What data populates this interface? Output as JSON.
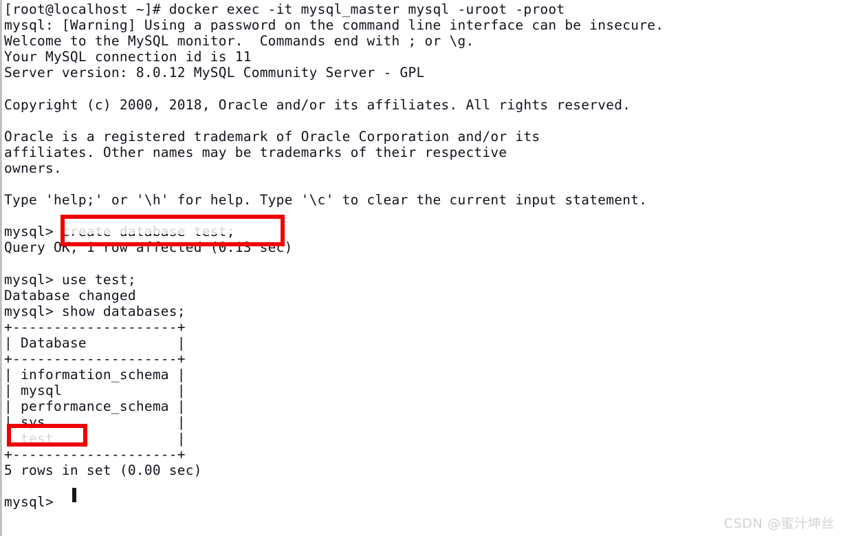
{
  "terminal": {
    "title": "MySQL monitor session in docker container",
    "background_color": "#ffffff",
    "text_color": "#13131f",
    "font_size_px": 19.5,
    "line_height_px": 23.1,
    "lines": [
      "[root@localhost ~]# docker exec -it mysql_master mysql -uroot -proot",
      "mysql: [Warning] Using a password on the command line interface can be insecure.",
      "Welcome to the MySQL monitor.  Commands end with ; or \\g.",
      "Your MySQL connection id is 11",
      "Server version: 8.0.12 MySQL Community Server - GPL",
      "",
      "Copyright (c) 2000, 2018, Oracle and/or its affiliates. All rights reserved.",
      "",
      "Oracle is a registered trademark of Oracle Corporation and/or its",
      "affiliates. Other names may be trademarks of their respective",
      "owners.",
      "",
      "Type 'help;' or '\\h' for help. Type '\\c' to clear the current input statement.",
      "",
      "mysql> create database test;",
      "Query OK, 1 row affected (0.13 sec)",
      "",
      "mysql> use test;",
      "Database changed",
      "mysql> show databases;",
      "+--------------------+",
      "| Database           |",
      "+--------------------+",
      "| information_schema |",
      "| mysql              |",
      "| performance_schema |",
      "| sys                |",
      "| test               |",
      "+--------------------+",
      "5 rows in set (0.00 sec)",
      "",
      "mysql> "
    ]
  },
  "session": {
    "shell_prompt": "[root@localhost ~]#",
    "shell_command": "docker exec -it mysql_master mysql -uroot -proot",
    "container_name": "mysql_master",
    "db_user": "root",
    "db_password": "root",
    "warning": "mysql: [Warning] Using a password on the command line interface can be insecure.",
    "welcome": "Welcome to the MySQL monitor.  Commands end with ; or \\g.",
    "connection_id": "Your MySQL connection id is 11",
    "server_version": "Server version: 8.0.12 MySQL Community Server - GPL",
    "copyright": "Copyright (c) 2000, 2018, Oracle and/or its affiliates. All rights reserved.",
    "trademark": "Oracle is a registered trademark of Oracle Corporation and/or its affiliates. Other names may be trademarks of their respective owners.",
    "help_hint": "Type 'help;' or '\\h' for help. Type '\\c' to clear the current input statement.",
    "mysql_prompt": "mysql>"
  },
  "commands": [
    {
      "prompt": "mysql>",
      "input": "create database test;",
      "result": "Query OK, 1 row affected (0.13 sec)",
      "highlighted": true
    },
    {
      "prompt": "mysql>",
      "input": "use test;",
      "result": "Database changed",
      "highlighted": false
    },
    {
      "prompt": "mysql>",
      "input": "show databases;",
      "result": "5 rows in set (0.00 sec)",
      "highlighted": false
    }
  ],
  "result_table": {
    "top_rule": "+--------------------+",
    "header_row": "| Database           |",
    "header_sep": "+--------------------+",
    "bottom_rule": "+--------------------+",
    "columns": [
      "Database"
    ],
    "rows": [
      "information_schema",
      "mysql",
      "performance_schema",
      "sys",
      "test"
    ],
    "row_count_label": "5 rows in set (0.00 sec)",
    "highlighted_row": "test"
  },
  "annotations": {
    "color": "#ee0000",
    "boxes": [
      {
        "name": "create-database-command",
        "target": "create database test;"
      },
      {
        "name": "test-database-row",
        "target": "test"
      }
    ]
  },
  "watermark": {
    "text": "CSDN @蜜汁坤丝",
    "color": "#d2d2d2"
  }
}
